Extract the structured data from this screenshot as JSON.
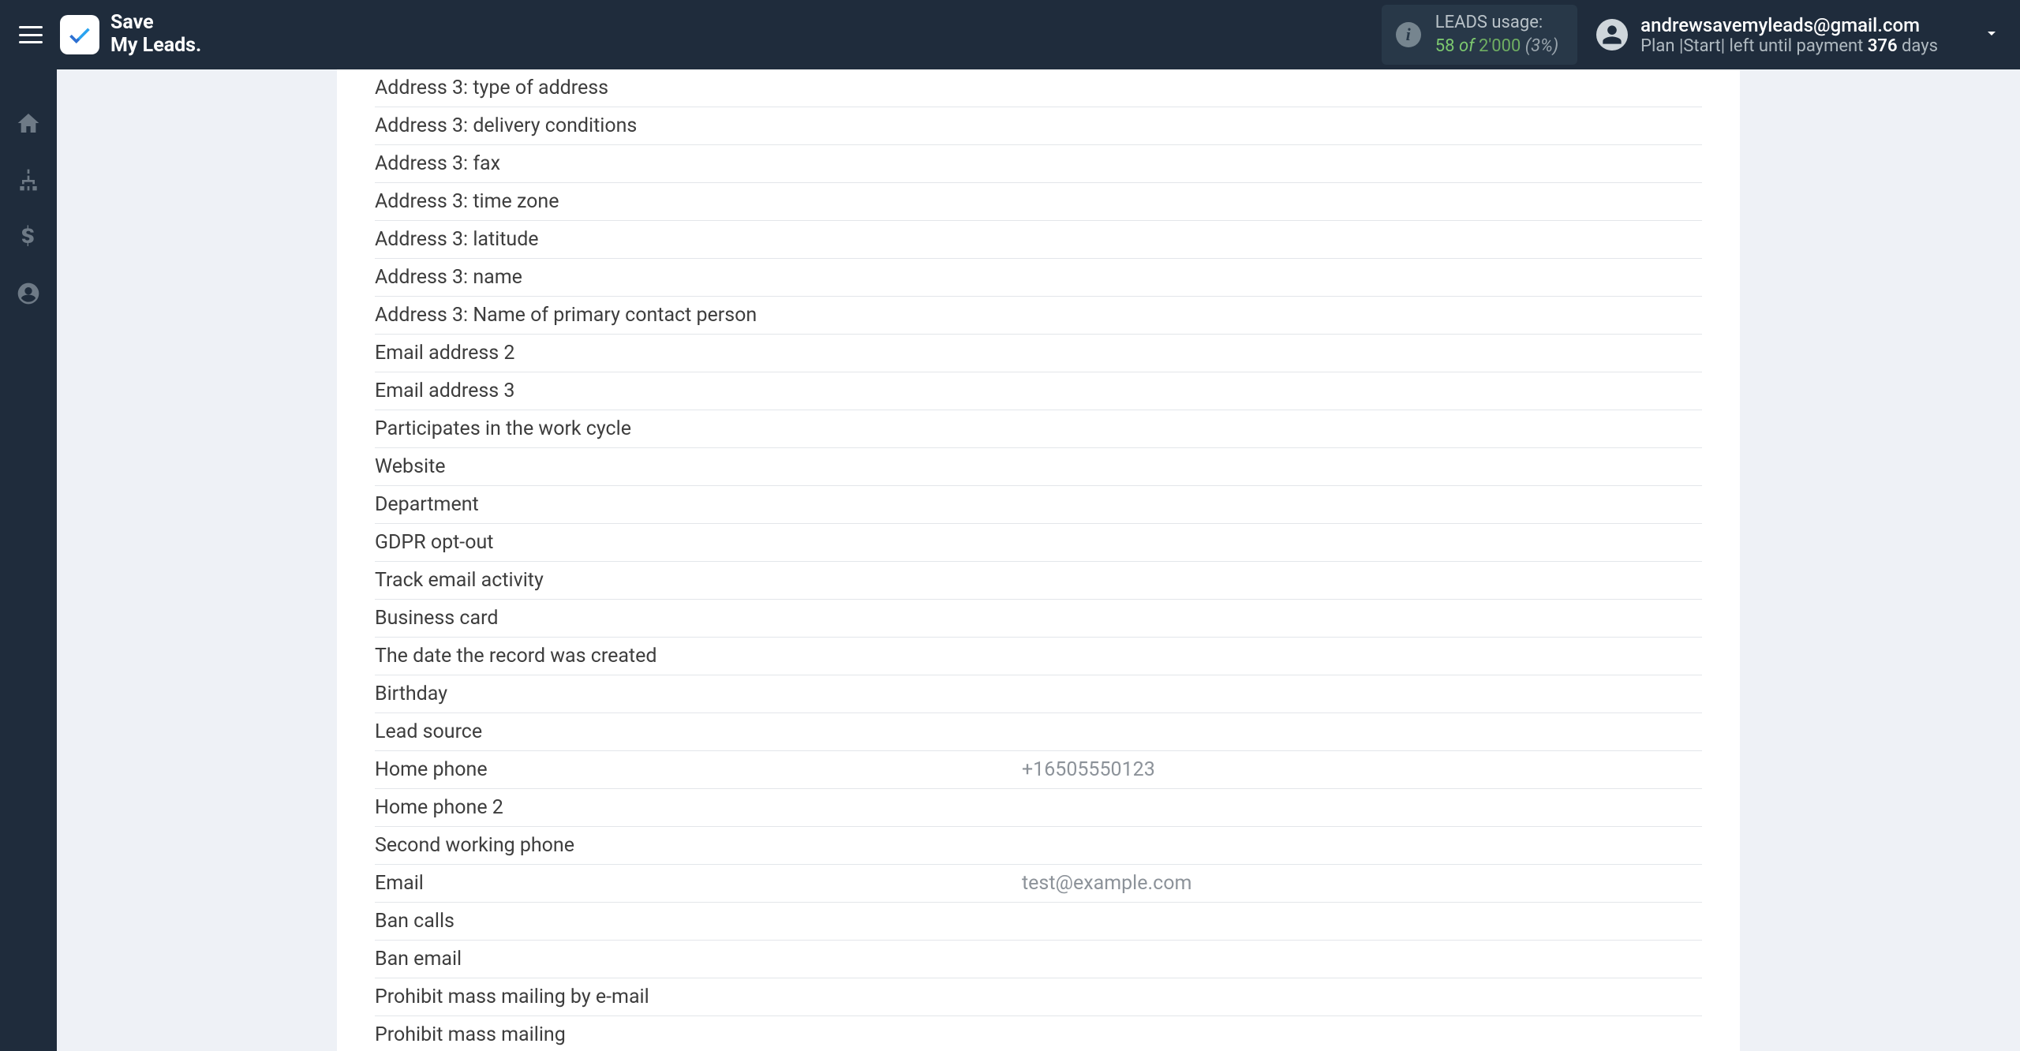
{
  "brand": {
    "line1": "Save",
    "line2": "My Leads."
  },
  "leads": {
    "label": "LEADS usage:",
    "used": "58",
    "of": "of",
    "total": "2'000",
    "pct": "(3%)"
  },
  "user": {
    "email": "andrewsavemyleads@gmail.com",
    "plan_prefix": "Plan |Start| left until payment ",
    "plan_days": "376",
    "plan_suffix": " days"
  },
  "fields": [
    {
      "label": "Address 3: type of address",
      "value": ""
    },
    {
      "label": "Address 3: delivery conditions",
      "value": ""
    },
    {
      "label": "Address 3: fax",
      "value": ""
    },
    {
      "label": "Address 3: time zone",
      "value": ""
    },
    {
      "label": "Address 3: latitude",
      "value": ""
    },
    {
      "label": "Address 3: name",
      "value": ""
    },
    {
      "label": "Address 3: Name of primary contact person",
      "value": ""
    },
    {
      "label": "Email address 2",
      "value": ""
    },
    {
      "label": "Email address 3",
      "value": ""
    },
    {
      "label": "Participates in the work cycle",
      "value": ""
    },
    {
      "label": "Website",
      "value": ""
    },
    {
      "label": "Department",
      "value": ""
    },
    {
      "label": "GDPR opt-out",
      "value": ""
    },
    {
      "label": "Track email activity",
      "value": ""
    },
    {
      "label": "Business card",
      "value": ""
    },
    {
      "label": "The date the record was created",
      "value": ""
    },
    {
      "label": "Birthday",
      "value": ""
    },
    {
      "label": "Lead source",
      "value": ""
    },
    {
      "label": "Home phone",
      "value": "+16505550123"
    },
    {
      "label": "Home phone 2",
      "value": ""
    },
    {
      "label": "Second working phone",
      "value": ""
    },
    {
      "label": "Email",
      "value": "test@example.com"
    },
    {
      "label": "Ban calls",
      "value": ""
    },
    {
      "label": "Ban email",
      "value": ""
    },
    {
      "label": "Prohibit mass mailing by e-mail",
      "value": ""
    },
    {
      "label": "Prohibit mass mailing",
      "value": ""
    }
  ]
}
